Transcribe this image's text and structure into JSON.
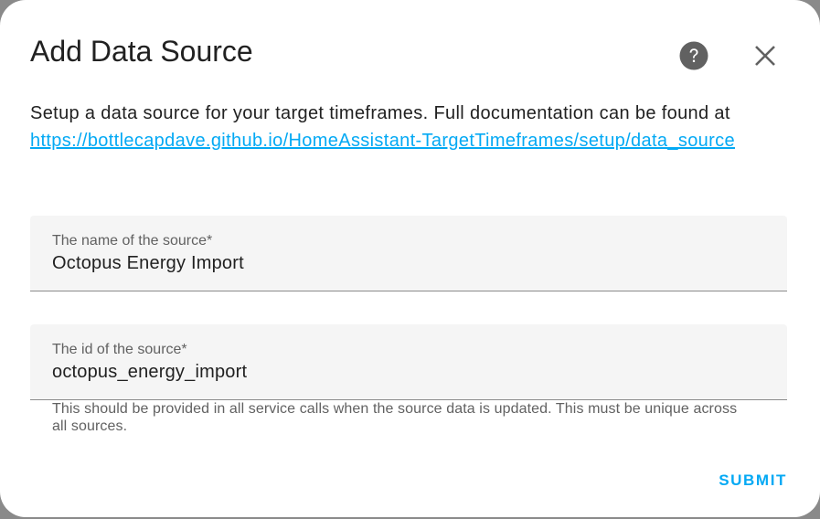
{
  "dialog": {
    "title": "Add Data Source",
    "description_prefix": "Setup a data source for your target timeframes. Full documentation can be found at ",
    "doc_link": "https://bottlecapdave.github.io/HomeAssistant-TargetTimeframes/setup/data_source",
    "help_icon": "help-circle-icon",
    "close_icon": "close-icon"
  },
  "fields": {
    "name": {
      "label": "The name of the source*",
      "value": "Octopus Energy Import"
    },
    "id": {
      "label": "The id of the source*",
      "value": "octopus_energy_import",
      "helper": "This should be provided in all service calls when the source data is updated. This must be unique across all sources."
    }
  },
  "actions": {
    "submit_label": "SUBMIT"
  },
  "colors": {
    "accent": "#03a9f4",
    "icon": "#616161",
    "field_bg": "#f5f5f5"
  }
}
